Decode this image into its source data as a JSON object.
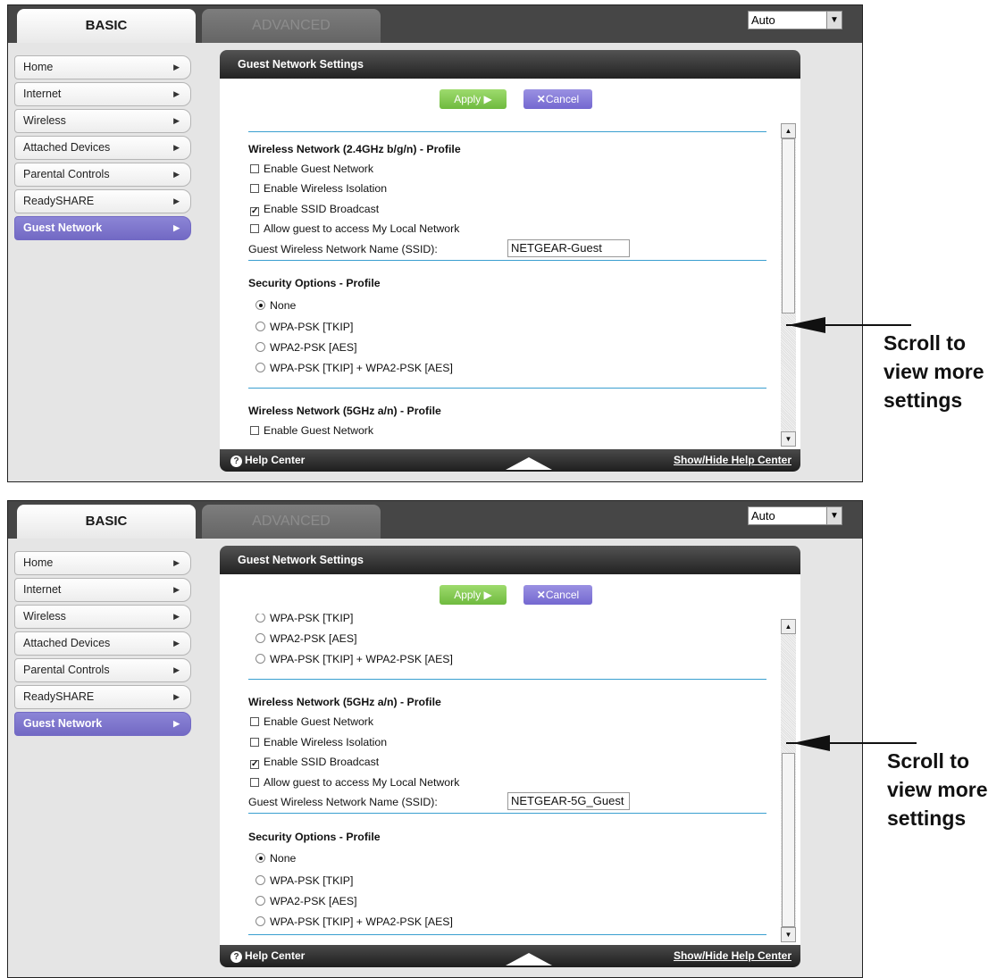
{
  "tabs": {
    "basic": "BASIC",
    "advanced": "ADVANCED"
  },
  "language": "Auto",
  "menu": [
    "Home",
    "Internet",
    "Wireless",
    "Attached Devices",
    "Parental Controls",
    "ReadySHARE",
    "Guest Network"
  ],
  "panel": {
    "title": "Guest Network Settings",
    "apply": "Apply ▶",
    "cancel": "Cancel"
  },
  "footer": {
    "help": "Help Center",
    "showhide": "Show/Hide Help Center"
  },
  "annotation": {
    "line1": "Scroll to",
    "line2": "view more",
    "line3": "settings"
  },
  "labels": {
    "wireless24": "Wireless Network (2.4GHz b/g/n) - Profile",
    "wireless5": "Wireless Network (5GHz a/n) - Profile",
    "enable_guest": "Enable Guest Network",
    "isolation": "Enable Wireless Isolation",
    "ssid_broadcast": "Enable SSID Broadcast",
    "allow_local": "Allow guest to access My Local Network",
    "ssid_name": "Guest Wireless Network Name (SSID):",
    "security": "Security Options - Profile",
    "none": "None",
    "wpa": "WPA-PSK [TKIP]",
    "wpa2": "WPA2-PSK [AES]",
    "mixed": "WPA-PSK [TKIP] + WPA2-PSK [AES]"
  },
  "values": {
    "ssid24": "NETGEAR-Guest",
    "ssid5": "NETGEAR-5G_Guest"
  },
  "state": {
    "enable_guest": false,
    "isolation": false,
    "ssid_broadcast": true,
    "allow_local": false,
    "security": "None"
  }
}
